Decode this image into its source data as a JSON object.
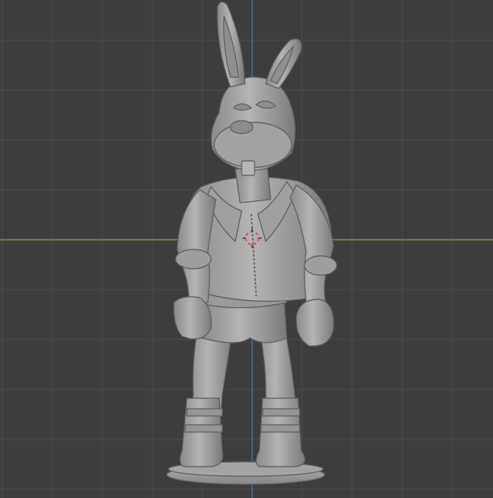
{
  "viewport": {
    "background": "#3d3d3d",
    "grid_color": "#4a4a4a",
    "x_axis_color": "#7a9e5a",
    "y_axis_color": "#4f74a6"
  },
  "model": {
    "subject": "rabbit-figurine",
    "clay_color": "#a8a8a8",
    "shadow_color": "#6e6e6e"
  },
  "cursor_3d": {
    "ring_color": "#e05050"
  }
}
